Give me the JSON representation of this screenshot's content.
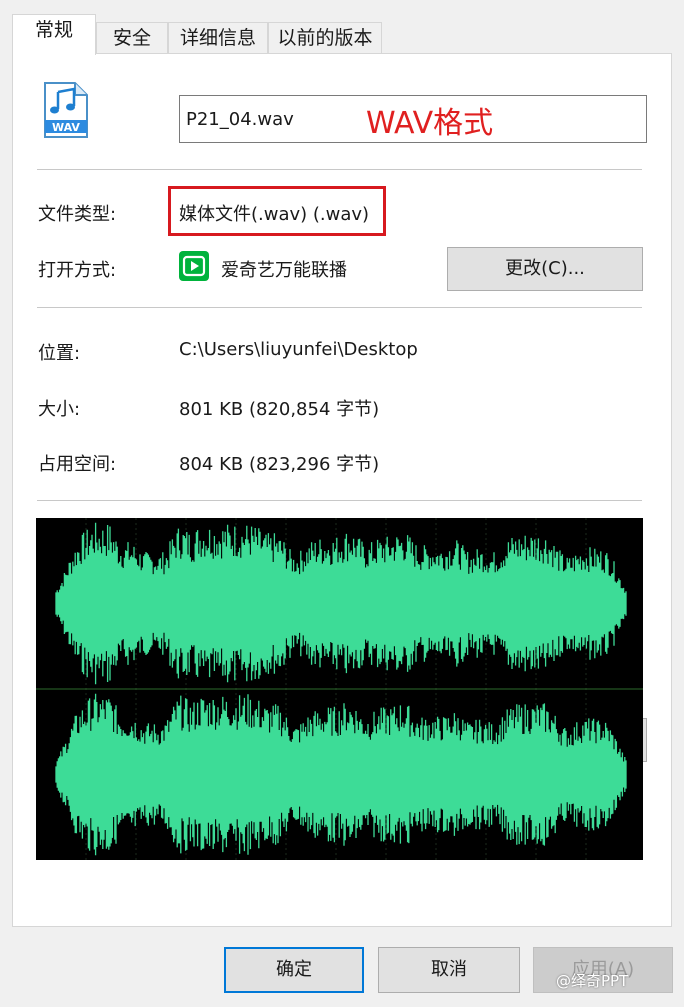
{
  "tabs": [
    {
      "label": "常规",
      "active": true
    },
    {
      "label": "安全",
      "active": false
    },
    {
      "label": "详细信息",
      "active": false
    },
    {
      "label": "以前的版本",
      "active": false
    }
  ],
  "file": {
    "name": "P21_04.wav",
    "icon": "music-file-icon",
    "icon_text": "WAV"
  },
  "annotation": {
    "text": "WAV格式",
    "color": "#e02020"
  },
  "type": {
    "label": "文件类型:",
    "value": "媒体文件(.wav) (.wav)"
  },
  "open_with": {
    "label": "打开方式:",
    "app_name": "爱奇艺万能联播",
    "app_icon": "iqiyi-app-icon",
    "change_button": "更改(C)..."
  },
  "location": {
    "label": "位置:",
    "value": "C:\\Users\\liuyunfei\\Desktop"
  },
  "size": {
    "label": "大小:",
    "value": "801 KB (820,854 字节)"
  },
  "size_on_disk": {
    "label": "占用空间:",
    "value": "804 KB (823,296 字节)"
  },
  "waveform": {
    "color": "#3ddc97",
    "background": "#000000",
    "channels": 2
  },
  "buttons": {
    "ok": "确定",
    "cancel": "取消",
    "apply": "应用(A)"
  },
  "watermark": "@绎奇PPT"
}
